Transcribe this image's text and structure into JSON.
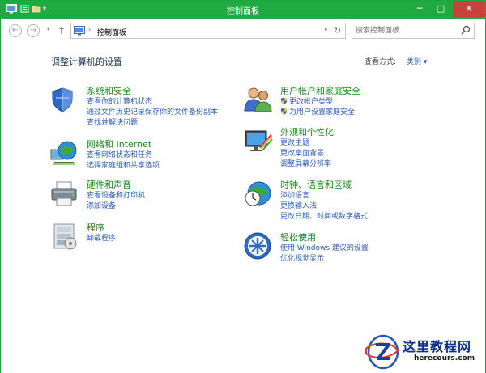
{
  "window": {
    "title": "控制面板",
    "minimize_glyph": "─",
    "maximize_glyph": "□",
    "close_glyph": "✕"
  },
  "toolbar": {
    "back_glyph": "←",
    "forward_glyph": "→",
    "up_glyph": "↑",
    "history_caret": "▾"
  },
  "address": {
    "separator": "›",
    "crumb": "控制面板",
    "dropdown": "▾",
    "refresh": "↻"
  },
  "search": {
    "placeholder": "搜索控制面板"
  },
  "page": {
    "title": "调整计算机的设置",
    "view_by_label": "查看方式:",
    "view_by_value": "类别 ▾"
  },
  "categories": [
    {
      "heading": "系统和安全",
      "icon": "shield-icon",
      "links": [
        "查看你的计算机状态",
        "通过文件历史记录保存你的文件备份副本",
        "查找并解决问题"
      ]
    },
    {
      "heading": "网络和 Internet",
      "icon": "network-globe-icon",
      "links": [
        "查看网络状态和任务",
        "选择家庭组和共享选项"
      ]
    },
    {
      "heading": "硬件和声音",
      "icon": "printer-icon",
      "links": [
        "查看设备和打印机",
        "添加设备"
      ]
    },
    {
      "heading": "程序",
      "icon": "programs-icon",
      "links": [
        "卸载程序"
      ]
    },
    {
      "heading": "用户帐户和家庭安全",
      "icon": "users-icon",
      "links": [
        "更改帐户类型",
        "为用户设置家庭安全"
      ]
    },
    {
      "heading": "外观和个性化",
      "icon": "appearance-icon",
      "links": [
        "更改主题",
        "更改桌面背景",
        "调整屏幕分辨率"
      ]
    },
    {
      "heading": "时钟、语言和区域",
      "icon": "clock-globe-icon",
      "links": [
        "添加语言",
        "更换输入法",
        "更改日期、时间或数字格式"
      ]
    },
    {
      "heading": "轻松使用",
      "icon": "ease-of-access-icon",
      "links": [
        "使用 Windows 建议的设置",
        "优化视觉显示"
      ]
    }
  ],
  "watermark": {
    "title": "这里教程网",
    "url": "herecours.com"
  },
  "colors": {
    "titlebar": "#21a942",
    "heading_green": "#1e8a1e",
    "link_blue": "#2a5cb8",
    "close_red": "#c7423a"
  }
}
